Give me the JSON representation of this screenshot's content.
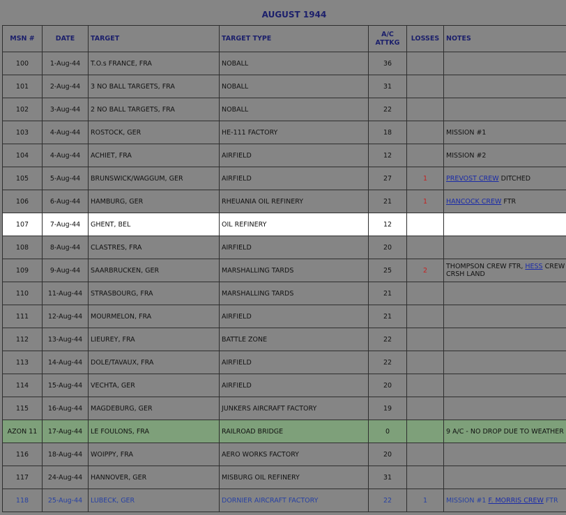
{
  "title": "AUGUST 1944",
  "headers": {
    "msn": "MSN #",
    "date": "DATE",
    "target": "TARGET",
    "target_type": "TARGET TYPE",
    "ac_attkg_1": "A/C",
    "ac_attkg_2": "ATTKG",
    "losses": "LOSSES",
    "notes": "NOTES"
  },
  "rows": [
    {
      "msn": "100",
      "date": "1-Aug-44",
      "target": "T.O.s FRANCE, FRA",
      "type": "NOBALL",
      "ac": "36",
      "losses": "",
      "notes": ""
    },
    {
      "msn": "101",
      "date": "2-Aug-44",
      "target": "3 NO BALL TARGETS, FRA",
      "type": "NOBALL",
      "ac": "31",
      "losses": "",
      "notes": ""
    },
    {
      "msn": "102",
      "date": "3-Aug-44",
      "target": "2 NO BALL TARGETS, FRA",
      "type": "NOBALL",
      "ac": "22",
      "losses": "",
      "notes": ""
    },
    {
      "msn": "103",
      "date": "4-Aug-44",
      "target": "ROSTOCK, GER",
      "type": "HE-111 FACTORY",
      "ac": "18",
      "losses": "",
      "notes": "MISSION #1"
    },
    {
      "msn": "104",
      "date": "4-Aug-44",
      "target": "ACHIET, FRA",
      "type": "AIRFIELD",
      "ac": "12",
      "losses": "",
      "notes": "MISSION #2"
    },
    {
      "msn": "105",
      "date": "5-Aug-44",
      "target": "BRUNSWICK/WAGGUM, GER",
      "type": "AIRFIELD",
      "ac": "27",
      "losses": "1",
      "notes_link": "PREVOST CREW",
      "notes_after": " DITCHED"
    },
    {
      "msn": "106",
      "date": "6-Aug-44",
      "target": "HAMBURG, GER",
      "type": "RHEUANIA OIL REFINERY",
      "ac": "21",
      "losses": "1",
      "notes_link": "HANCOCK CREW",
      "notes_after": " FTR"
    },
    {
      "msn": "107",
      "date": "7-Aug-44",
      "target": "GHENT, BEL",
      "type": "OIL REFINERY",
      "ac": "12",
      "losses": "",
      "notes": ""
    },
    {
      "msn": "108",
      "date": "8-Aug-44",
      "target": "CLASTRES, FRA",
      "type": "AIRFIELD",
      "ac": "20",
      "losses": "",
      "notes": ""
    },
    {
      "msn": "109",
      "date": "9-Aug-44",
      "target": "SAARBRUCKEN, GER",
      "type": "MARSHALLING TARDS",
      "ac": "25",
      "losses": "2",
      "notes_before": "THOMPSON CREW FTR, ",
      "notes_link": "HESS",
      "notes_after": " CREW CRSH LAND"
    },
    {
      "msn": "110",
      "date": "11-Aug-44",
      "target": "STRASBOURG, FRA",
      "type": "MARSHALLING TARDS",
      "ac": "21",
      "losses": "",
      "notes": ""
    },
    {
      "msn": "111",
      "date": "12-Aug-44",
      "target": "MOURMELON, FRA",
      "type": "AIRFIELD",
      "ac": "21",
      "losses": "",
      "notes": ""
    },
    {
      "msn": "112",
      "date": "13-Aug-44",
      "target": "LIEUREY, FRA",
      "type": "BATTLE ZONE",
      "ac": "22",
      "losses": "",
      "notes": ""
    },
    {
      "msn": "113",
      "date": "14-Aug-44",
      "target": "DOLE/TAVAUX, FRA",
      "type": "AIRFIELD",
      "ac": "22",
      "losses": "",
      "notes": ""
    },
    {
      "msn": "114",
      "date": "15-Aug-44",
      "target": "VECHTA, GER",
      "type": "AIRFIELD",
      "ac": "20",
      "losses": "",
      "notes": ""
    },
    {
      "msn": "115",
      "date": "16-Aug-44",
      "target": "MAGDEBURG, GER",
      "type": "JUNKERS AIRCRAFT FACTORY",
      "ac": "19",
      "losses": "",
      "notes": ""
    },
    {
      "msn": "AZON 11",
      "date": "17-Aug-44",
      "target": "LE FOULONS, FRA",
      "type": "RAILROAD BRIDGE",
      "ac": "0",
      "losses": "",
      "notes": "9 A/C - NO DROP DUE TO WEATHER"
    },
    {
      "msn": "116",
      "date": "18-Aug-44",
      "target": "WOIPPY, FRA",
      "type": "AERO WORKS FACTORY",
      "ac": "20",
      "losses": "",
      "notes": ""
    },
    {
      "msn": "117",
      "date": "24-Aug-44",
      "target": "HANNOVER, GER",
      "type": "MISBURG OIL REFINERY",
      "ac": "31",
      "losses": "",
      "notes": ""
    },
    {
      "msn": "118",
      "date": "25-Aug-44",
      "target": "LUBECK, GER",
      "type": "DORNIER AIRCRAFT FACTORY",
      "ac": "22",
      "losses": "1",
      "notes_before": "MISSION #1  ",
      "notes_link": "F. MORRIS CREW",
      "notes_after": " FTR"
    }
  ]
}
